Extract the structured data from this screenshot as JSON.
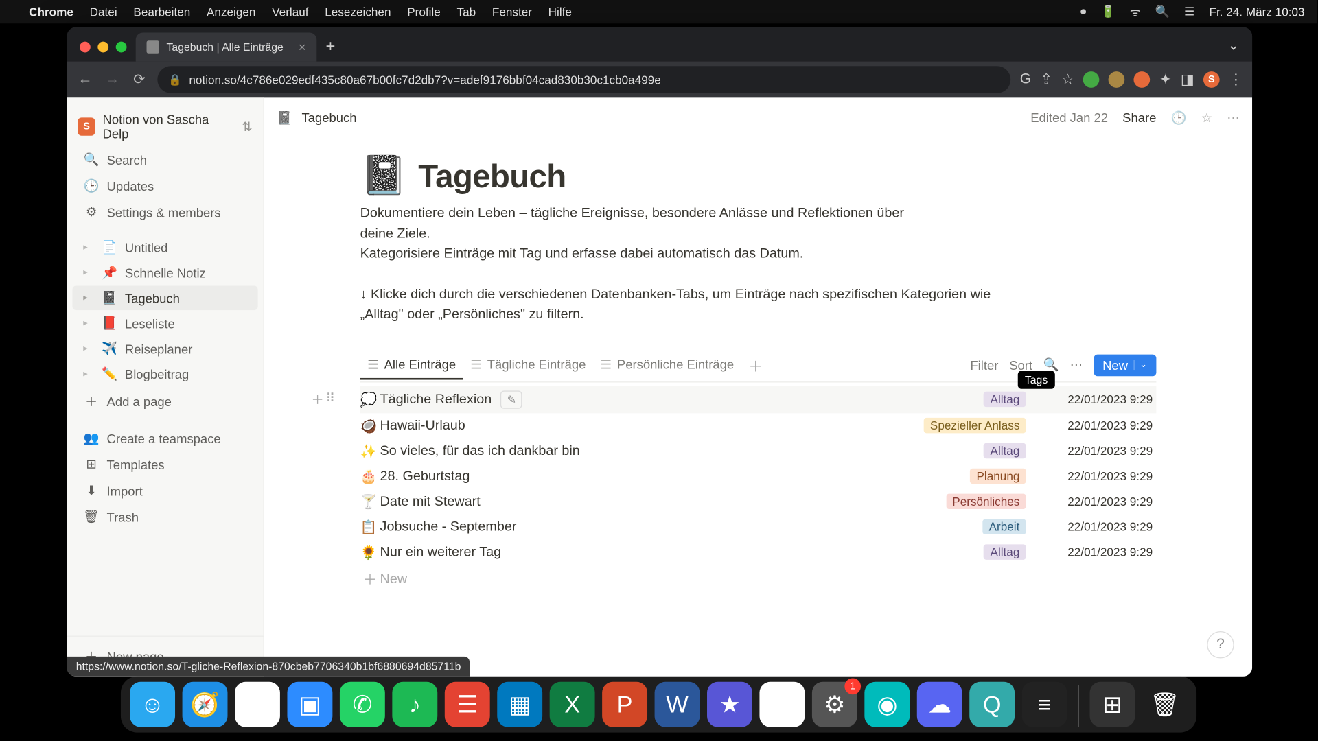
{
  "menubar": {
    "app": "Chrome",
    "items": [
      "Datei",
      "Bearbeiten",
      "Anzeigen",
      "Verlauf",
      "Lesezeichen",
      "Profile",
      "Tab",
      "Fenster",
      "Hilfe"
    ],
    "clock": "Fr. 24. März  10:03"
  },
  "browser": {
    "tab_title": "Tagebuch | Alle Einträge",
    "url": "notion.so/4c786e029edf435c80a67b00fc7d2db7?v=adef9176bbf04cad830b30c1cb0a499e",
    "status_url": "https://www.notion.so/T-gliche-Reflexion-870cbeb7706340b1bf6880694d85711b"
  },
  "sidebar": {
    "workspace": "Notion von Sascha Delp",
    "workspace_initial": "S",
    "nav": [
      {
        "icon": "🔍",
        "label": "Search"
      },
      {
        "icon": "🕒",
        "label": "Updates"
      },
      {
        "icon": "⚙",
        "label": "Settings & members"
      }
    ],
    "pages": [
      {
        "emo": "📄",
        "label": "Untitled"
      },
      {
        "emo": "📌",
        "label": "Schnelle Notiz"
      },
      {
        "emo": "📓",
        "label": "Tagebuch",
        "active": true
      },
      {
        "emo": "📕",
        "label": "Leseliste"
      },
      {
        "emo": "✈️",
        "label": "Reiseplaner"
      },
      {
        "emo": "✏️",
        "label": "Blogbeitrag"
      }
    ],
    "add_page": "Add a page",
    "util": [
      {
        "icon": "👥",
        "label": "Create a teamspace"
      },
      {
        "icon": "⊞",
        "label": "Templates"
      },
      {
        "icon": "⬇",
        "label": "Import"
      },
      {
        "icon": "🗑",
        "label": "Trash"
      }
    ],
    "new_page": "New page"
  },
  "topbar": {
    "breadcrumb": "Tagebuch",
    "edited": "Edited Jan 22",
    "share": "Share"
  },
  "page": {
    "emoji": "📓",
    "title": "Tagebuch",
    "desc1": "Dokumentiere dein Leben – tägliche Ereignisse, besondere Anlässe und Reflektionen über deine Ziele.",
    "desc2": "Kategorisiere Einträge mit Tag und erfasse dabei automatisch das Datum.",
    "hint": "↓ Klicke dich durch die verschiedenen Datenbanken-Tabs, um Einträge nach spezifischen Kategorien wie „Alltag\" oder „Persönliches\" zu filtern."
  },
  "db": {
    "tabs": [
      {
        "label": "Alle Einträge",
        "active": true
      },
      {
        "label": "Tägliche Einträge"
      },
      {
        "label": "Persönliche Einträge"
      }
    ],
    "tools": {
      "filter": "Filter",
      "sort": "Sort",
      "new": "New"
    },
    "tooltip": "Tags",
    "rows": [
      {
        "emo": "💭",
        "title": "Tägliche Reflexion",
        "tag": "Alltag",
        "tag_class": "tag-alltag",
        "date": "22/01/2023 9:29",
        "hovered": true
      },
      {
        "emo": "🥥",
        "title": "Hawaii-Urlaub",
        "tag": "Spezieller Anlass",
        "tag_class": "tag-spezieller",
        "date": "22/01/2023 9:29"
      },
      {
        "emo": "✨",
        "title": "So vieles, für das ich dankbar bin",
        "tag": "Alltag",
        "tag_class": "tag-alltag",
        "date": "22/01/2023 9:29"
      },
      {
        "emo": "🎂",
        "title": "28. Geburtstag",
        "tag": "Planung",
        "tag_class": "tag-planung",
        "date": "22/01/2023 9:29"
      },
      {
        "emo": "🍸",
        "title": "Date mit Stewart",
        "tag": "Persönliches",
        "tag_class": "tag-persoenliches",
        "date": "22/01/2023 9:29"
      },
      {
        "emo": "📋",
        "title": "Jobsuche - September",
        "tag": "Arbeit",
        "tag_class": "tag-arbeit",
        "date": "22/01/2023 9:29"
      },
      {
        "emo": "🌻",
        "title": "Nur ein weiterer Tag",
        "tag": "Alltag",
        "tag_class": "tag-alltag",
        "date": "22/01/2023 9:29"
      }
    ],
    "new_row": "New"
  },
  "dock": {
    "apps": [
      {
        "name": "finder",
        "bg": "#2aa8f0",
        "glyph": "☺"
      },
      {
        "name": "safari",
        "bg": "#1e8fe6",
        "glyph": "🧭"
      },
      {
        "name": "chrome",
        "bg": "#fff",
        "glyph": "◉"
      },
      {
        "name": "zoom",
        "bg": "#2d8cff",
        "glyph": "▣"
      },
      {
        "name": "whatsapp",
        "bg": "#25d366",
        "glyph": "✆"
      },
      {
        "name": "spotify",
        "bg": "#1db954",
        "glyph": "♪"
      },
      {
        "name": "todoist",
        "bg": "#e44332",
        "glyph": "☰"
      },
      {
        "name": "trello",
        "bg": "#0079bf",
        "glyph": "▦"
      },
      {
        "name": "excel",
        "bg": "#107c41",
        "glyph": "X"
      },
      {
        "name": "powerpoint",
        "bg": "#d24726",
        "glyph": "P"
      },
      {
        "name": "word",
        "bg": "#2b579a",
        "glyph": "W"
      },
      {
        "name": "imovie",
        "bg": "#5856d6",
        "glyph": "★"
      },
      {
        "name": "drive",
        "bg": "#fff",
        "glyph": "▲"
      },
      {
        "name": "settings",
        "bg": "#555",
        "glyph": "⚙",
        "badge": "1"
      },
      {
        "name": "siri",
        "bg": "#0bb",
        "glyph": "◉"
      },
      {
        "name": "discord",
        "bg": "#5865f2",
        "glyph": "☁"
      },
      {
        "name": "quicktime",
        "bg": "#3aa",
        "glyph": "Q"
      },
      {
        "name": "voice",
        "bg": "#222",
        "glyph": "≡"
      }
    ],
    "right": [
      {
        "name": "launchpad",
        "bg": "#333",
        "glyph": "⊞"
      },
      {
        "name": "trash",
        "bg": "transparent",
        "glyph": "🗑"
      }
    ]
  }
}
